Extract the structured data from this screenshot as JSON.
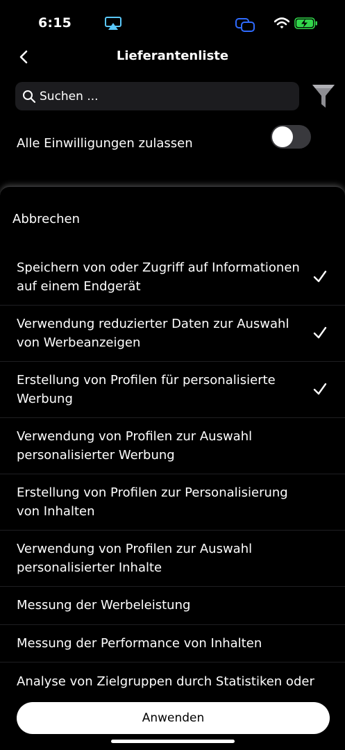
{
  "status_bar": {
    "time": "6:15",
    "icons": [
      "airplay-icon",
      "screen-mirroring-icon",
      "wifi-icon",
      "battery-charging-icon"
    ],
    "colors": {
      "airplay": "#5ac8fa",
      "screen_mirroring": "#2f6bff",
      "battery": "#32d74b"
    }
  },
  "nav": {
    "back_icon": "chevron-left-icon",
    "title": "Lieferantenliste"
  },
  "search": {
    "placeholder": "Suchen ..."
  },
  "filter_icon": "funnel-icon",
  "consent_toggle": {
    "label": "Alle Einwilligungen zulassen",
    "on": false
  },
  "sheet": {
    "cancel_label": "Abbrechen",
    "items": [
      {
        "label": "Speichern von oder Zugriff auf Informationen auf einem Endgerät",
        "checked": true
      },
      {
        "label": "Verwendung reduzierter Daten zur Auswahl von Werbeanzeigen",
        "checked": true
      },
      {
        "label": "Erstellung von Profilen für personalisierte Werbung",
        "checked": true
      },
      {
        "label": "Verwendung von Profilen zur Auswahl personalisierter Werbung",
        "checked": false
      },
      {
        "label": "Erstellung von Profilen zur Personalisierung von Inhalten",
        "checked": false
      },
      {
        "label": "Verwendung von Profilen zur Auswahl personalisierter Inhalte",
        "checked": false
      },
      {
        "label": "Messung der Werbeleistung",
        "checked": false
      },
      {
        "label": "Messung der Performance von Inhalten",
        "checked": false
      },
      {
        "label": "Analyse von Zielgruppen durch Statistiken oder",
        "checked": false
      }
    ],
    "apply_label": "Anwenden"
  }
}
